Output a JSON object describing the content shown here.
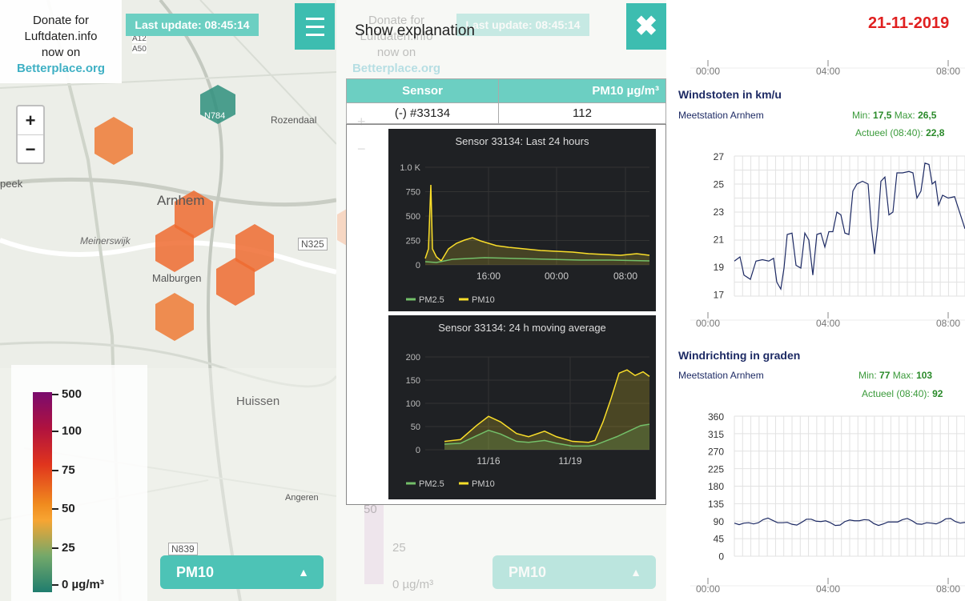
{
  "left_panel": {
    "donate": {
      "line1": "Donate for",
      "line2": "Luftdaten.info",
      "line3": "now on",
      "link": "Betterplace.org"
    },
    "last_update": "Last update: 08:45:14",
    "zoom_in": "+",
    "zoom_out": "−",
    "map_labels": {
      "arnhem": "Arnhem",
      "malburgen": "Malburgen",
      "huissen": "Huissen",
      "meinerswijk": "Meinerswijk",
      "rozendaal": "Rozendaal",
      "n325": "N325",
      "n784": "N784",
      "a12": "A12",
      "a50": "A50",
      "angeren": "Angeren",
      "n839": "N839",
      "oeek": "peek"
    },
    "legend": [
      "500",
      "100",
      "75",
      "50",
      "25",
      "0 µg/m³"
    ],
    "pm_select": "PM10"
  },
  "middle_panel": {
    "show_explanation": "Show explanation",
    "table": {
      "headers": [
        "Sensor",
        "PM10 µg/m³"
      ],
      "row": [
        "(-) #33134",
        "112"
      ]
    },
    "chart1": {
      "title": "Sensor 33134: Last 24 hours",
      "yticks": [
        "1.0 K",
        "750",
        "500",
        "250",
        "0"
      ],
      "xticks": [
        "16:00",
        "00:00",
        "08:00"
      ],
      "legend": [
        "PM2.5",
        "PM10"
      ]
    },
    "chart2": {
      "title": "Sensor 33134: 24 h moving average",
      "yticks": [
        "200",
        "150",
        "100",
        "50",
        "0"
      ],
      "xticks": [
        "11/16",
        "11/19"
      ],
      "legend": [
        "PM2.5",
        "PM10"
      ]
    }
  },
  "right_panel": {
    "date": "21-11-2019",
    "time_ticks": [
      "00:00",
      "04:00",
      "08:00"
    ],
    "wind_gusts": {
      "title": "Windstoten in km/u",
      "station": "Meetstation Arnhem",
      "min_label": "Min:",
      "min": "17,5",
      "max_label": "Max:",
      "max": "26,5",
      "current": "Actueel (08:40):",
      "current_val": "22,8",
      "yticks": [
        "27",
        "25",
        "23",
        "21",
        "19",
        "17"
      ]
    },
    "wind_dir": {
      "title": "Windrichting in graden",
      "station": "Meetstation Arnhem",
      "min_label": "Min:",
      "min": "77",
      "max_label": "Max:",
      "max": "103",
      "current": "Actueel (08:40):",
      "current_val": "92",
      "yticks": [
        "360",
        "315",
        "270",
        "225",
        "180",
        "135",
        "90",
        "45",
        "0"
      ]
    }
  },
  "colors": {
    "teal": "#3dbdb0",
    "accent": "#6ccfc2",
    "date": "#e02020",
    "pm25": "#73bf69",
    "pm10": "#fade2a"
  }
}
